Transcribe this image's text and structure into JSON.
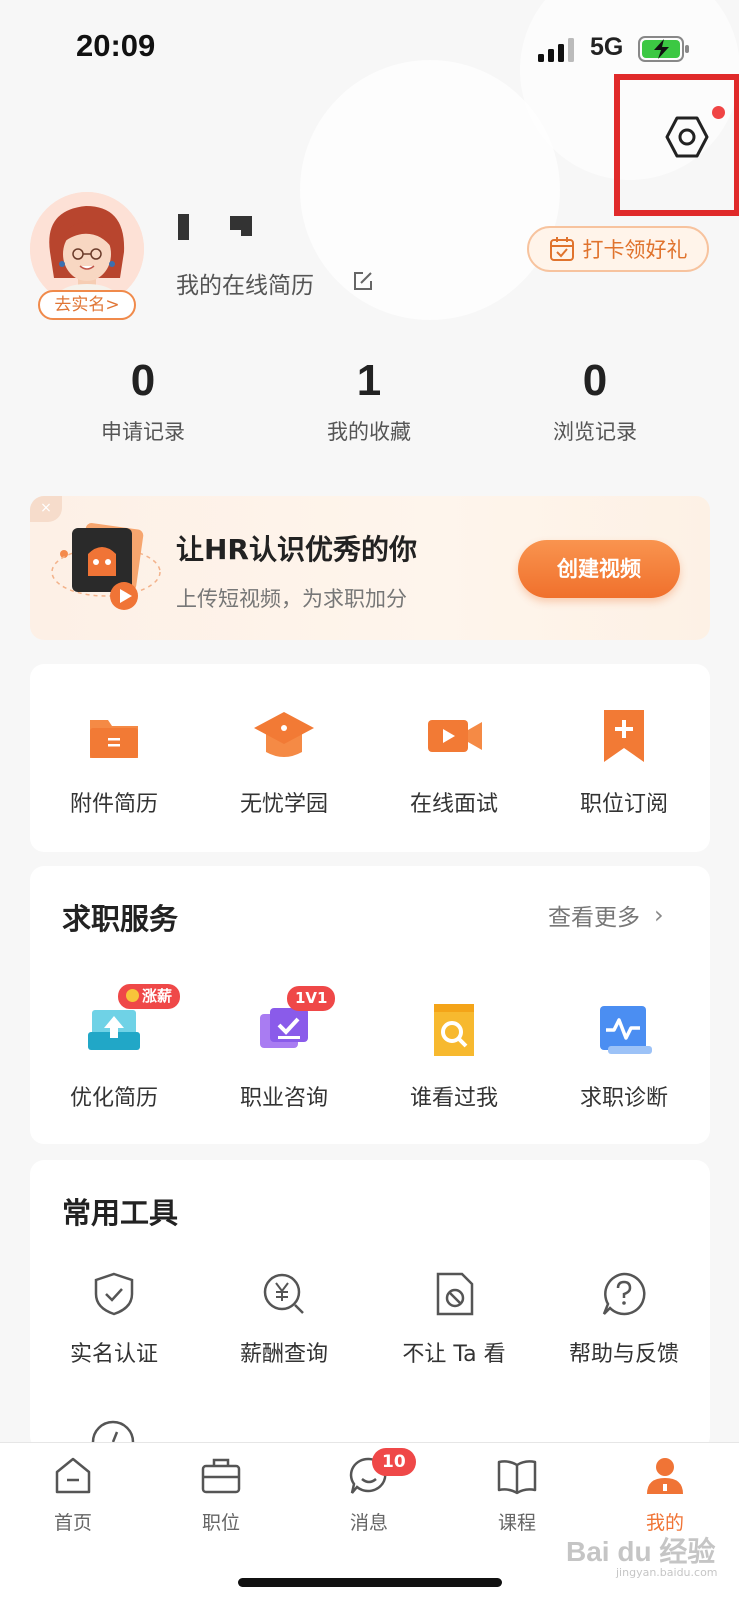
{
  "status_bar": {
    "time": "20:09",
    "network": "5G"
  },
  "profile": {
    "verify_label": "去实名",
    "resume_link": "我的在线简历",
    "checkin_label": "打卡领好礼"
  },
  "stats": [
    {
      "value": "0",
      "label": "申请记录"
    },
    {
      "value": "1",
      "label": "我的收藏"
    },
    {
      "value": "0",
      "label": "浏览记录"
    }
  ],
  "banner": {
    "title": "让HR认识优秀的你",
    "subtitle": "上传短视频，为求职加分",
    "button": "创建视频",
    "close": "×"
  },
  "quick_actions": [
    {
      "label": "附件简历",
      "icon": "folder-icon"
    },
    {
      "label": "无忧学园",
      "icon": "graduation-cap-icon"
    },
    {
      "label": "在线面试",
      "icon": "video-camera-icon"
    },
    {
      "label": "职位订阅",
      "icon": "bookmark-plus-icon"
    }
  ],
  "job_services": {
    "title": "求职服务",
    "more": "查看更多",
    "items": [
      {
        "label": "优化简历",
        "icon": "upload-resume-icon",
        "badge": "涨薪"
      },
      {
        "label": "职业咨询",
        "icon": "consult-icon",
        "badge": "1V1"
      },
      {
        "label": "谁看过我",
        "icon": "search-document-icon"
      },
      {
        "label": "求职诊断",
        "icon": "diagnosis-icon"
      }
    ]
  },
  "tools": {
    "title": "常用工具",
    "items": [
      {
        "label": "实名认证",
        "icon": "shield-check-icon"
      },
      {
        "label": "薪酬查询",
        "icon": "yuan-search-icon"
      },
      {
        "label": "不让 Ta 看",
        "icon": "block-document-icon"
      },
      {
        "label": "帮助与反馈",
        "icon": "help-icon"
      }
    ]
  },
  "tabbar": {
    "items": [
      {
        "label": "首页",
        "icon": "home-icon"
      },
      {
        "label": "职位",
        "icon": "briefcase-icon"
      },
      {
        "label": "消息",
        "icon": "message-icon",
        "badge": "10"
      },
      {
        "label": "课程",
        "icon": "book-icon"
      },
      {
        "label": "我的",
        "icon": "user-icon",
        "active": true
      }
    ]
  },
  "watermark": {
    "main": "Bai du 经验",
    "sub": "jingyan.baidu.com"
  },
  "colors": {
    "accent": "#f07436",
    "highlight_box": "#e02a2a",
    "badge": "#ef4848"
  }
}
